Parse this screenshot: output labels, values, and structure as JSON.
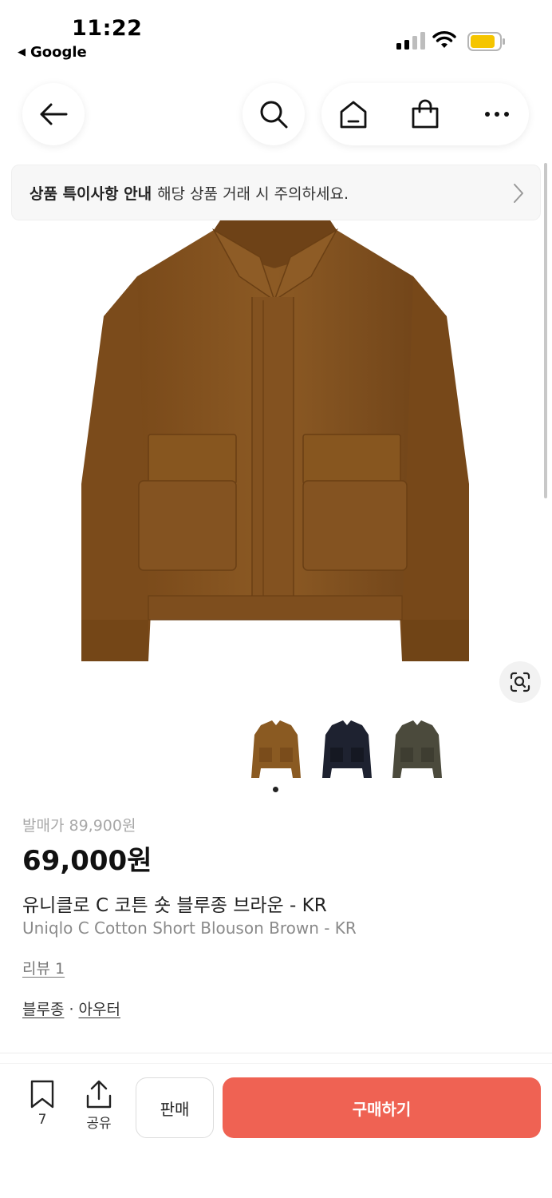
{
  "status_bar": {
    "time": "11:22",
    "back_app": "Google"
  },
  "notice": {
    "title": "상품 특이사항 안내",
    "text": "해당 상품 거래 시 주의하세요."
  },
  "product": {
    "original_price": "발매가 89,900원",
    "price": "69,000원",
    "name_ko": "유니클로 C 코튼 숏 블루종 브라운 - KR",
    "name_en": "Uniqlo C Cotton Short Blouson Brown - KR",
    "review": "리뷰 1",
    "categories": [
      "블루종",
      "아우터"
    ],
    "category_separator": "·",
    "thumbnails": [
      {
        "color_name": "brown",
        "color": "#8a5a22"
      },
      {
        "color_name": "navy",
        "color": "#1e2230"
      },
      {
        "color_name": "olive",
        "color": "#4b4a3c"
      }
    ],
    "image_count": 1,
    "current_image": 1
  },
  "bottom_bar": {
    "bookmark_count": "7",
    "share_label": "공유",
    "sell_label": "판매",
    "buy_label": "구매하기",
    "buy_color": "#ef6253"
  },
  "icons": {
    "back": "arrow-left-icon",
    "search": "search-icon",
    "home": "home-icon",
    "bag": "shopping-bag-icon",
    "more": "more-horizontal-icon",
    "lens": "image-search-icon"
  }
}
